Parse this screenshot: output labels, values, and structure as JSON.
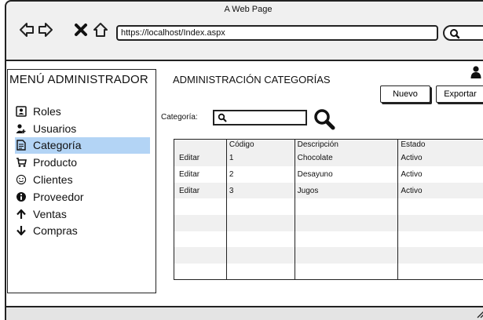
{
  "browser": {
    "title": "A Web Page",
    "url": "https://localhost/Index.aspx"
  },
  "sidebar": {
    "title": "MENÚ ADMINISTRADOR",
    "items": [
      {
        "label": "Roles",
        "icon": "id-card-icon",
        "active": false
      },
      {
        "label": "Usuarios",
        "icon": "add-user-icon",
        "active": false
      },
      {
        "label": "Categoría",
        "icon": "document-icon",
        "active": true
      },
      {
        "label": "Producto",
        "icon": "cart-icon",
        "active": false
      },
      {
        "label": "Clientes",
        "icon": "smiley-icon",
        "active": false
      },
      {
        "label": "Proveedor",
        "icon": "info-icon",
        "active": false
      },
      {
        "label": "Ventas",
        "icon": "arrow-up-icon",
        "active": false
      },
      {
        "label": "Compras",
        "icon": "arrow-down-icon",
        "active": false
      }
    ],
    "active_color": "#b3d4f5"
  },
  "main": {
    "title": "ADMINISTRACIÓN CATEGORÍAS",
    "search_label": "Categoría:",
    "search_value": "",
    "new_label": "Nuevo",
    "export_label": "Exportar"
  },
  "table": {
    "columns": [
      "",
      "Código",
      "Descripción",
      "Estado"
    ],
    "rows": [
      {
        "action": "Editar",
        "codigo": "1",
        "descripcion": "Chocolate",
        "estado": "Activo"
      },
      {
        "action": "Editar",
        "codigo": "2",
        "descripcion": "Desayuno",
        "estado": "Activo"
      },
      {
        "action": "Editar",
        "codigo": "3",
        "descripcion": "Jugos",
        "estado": "Activo"
      }
    ]
  }
}
